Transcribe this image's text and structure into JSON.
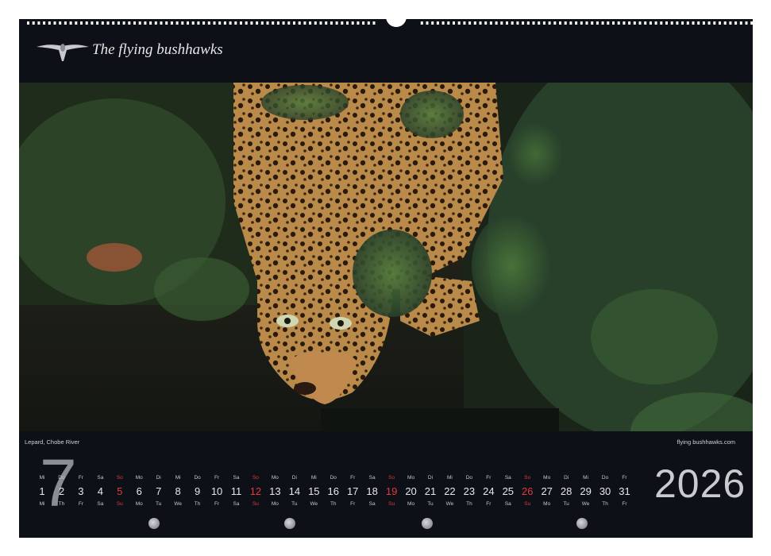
{
  "brand": {
    "title": "The flying bushhawks",
    "logo_icon": "bird-icon"
  },
  "photo": {
    "caption": "Lepard, Chobe River",
    "credit": "flying bushhawks.com"
  },
  "calendar": {
    "month_number": "7",
    "year": "2026",
    "days": [
      {
        "n": "1",
        "top": "Mi",
        "bottom": "Mi"
      },
      {
        "n": "2",
        "top": "Do",
        "bottom": "Th"
      },
      {
        "n": "3",
        "top": "Fr",
        "bottom": "Fr"
      },
      {
        "n": "4",
        "top": "Sa",
        "bottom": "Sa"
      },
      {
        "n": "5",
        "top": "So",
        "bottom": "Su",
        "red": true
      },
      {
        "n": "6",
        "top": "Mo",
        "bottom": "Mo"
      },
      {
        "n": "7",
        "top": "Di",
        "bottom": "Tu"
      },
      {
        "n": "8",
        "top": "Mi",
        "bottom": "We"
      },
      {
        "n": "9",
        "top": "Do",
        "bottom": "Th"
      },
      {
        "n": "10",
        "top": "Fr",
        "bottom": "Fr"
      },
      {
        "n": "11",
        "top": "Sa",
        "bottom": "Sa"
      },
      {
        "n": "12",
        "top": "So",
        "bottom": "Su",
        "red": true
      },
      {
        "n": "13",
        "top": "Mo",
        "bottom": "Mo"
      },
      {
        "n": "14",
        "top": "Di",
        "bottom": "Tu"
      },
      {
        "n": "15",
        "top": "Mi",
        "bottom": "We"
      },
      {
        "n": "16",
        "top": "Do",
        "bottom": "Th"
      },
      {
        "n": "17",
        "top": "Fr",
        "bottom": "Fr"
      },
      {
        "n": "18",
        "top": "Sa",
        "bottom": "Sa"
      },
      {
        "n": "19",
        "top": "So",
        "bottom": "Su",
        "red": true
      },
      {
        "n": "20",
        "top": "Mo",
        "bottom": "Mo"
      },
      {
        "n": "21",
        "top": "Di",
        "bottom": "Tu"
      },
      {
        "n": "22",
        "top": "Mi",
        "bottom": "We"
      },
      {
        "n": "23",
        "top": "Do",
        "bottom": "Th"
      },
      {
        "n": "24",
        "top": "Fr",
        "bottom": "Fr"
      },
      {
        "n": "25",
        "top": "Sa",
        "bottom": "Sa"
      },
      {
        "n": "26",
        "top": "So",
        "bottom": "Su",
        "red": true
      },
      {
        "n": "27",
        "top": "Mo",
        "bottom": "Mo"
      },
      {
        "n": "28",
        "top": "Di",
        "bottom": "Tu"
      },
      {
        "n": "29",
        "top": "Mi",
        "bottom": "We"
      },
      {
        "n": "30",
        "top": "Do",
        "bottom": "Th"
      },
      {
        "n": "31",
        "top": "Fr",
        "bottom": "Fr"
      }
    ],
    "moon_phase_icons": [
      "moon-phase-icon",
      "moon-phase-icon",
      "moon-phase-icon",
      "moon-phase-icon"
    ]
  },
  "colors": {
    "background": "#0d1016",
    "sunday": "#e2393f",
    "text": "#e6e8eb"
  }
}
